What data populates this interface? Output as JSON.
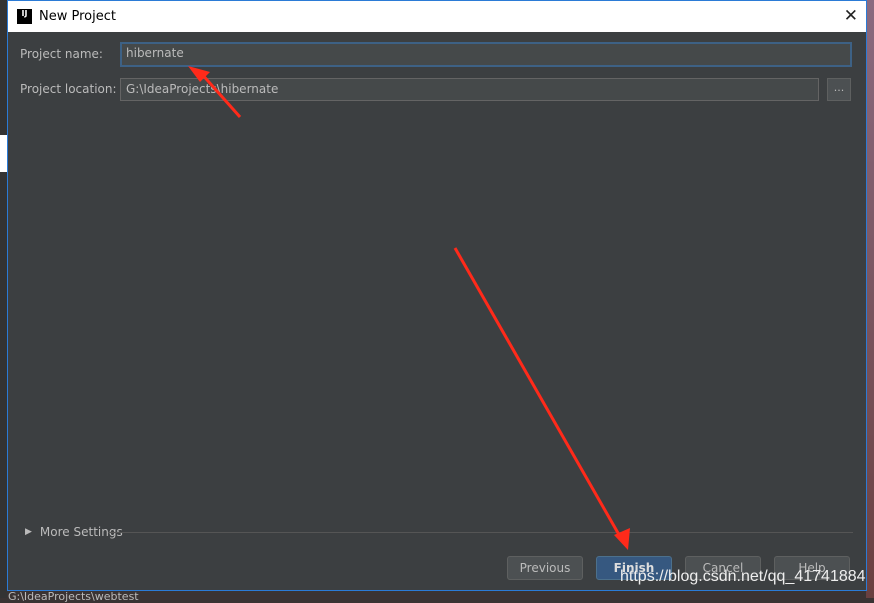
{
  "window": {
    "title": "New Project",
    "logo": "IJ"
  },
  "form": {
    "name_label": "Project name:",
    "name_value": "hibernate",
    "location_label": "Project location:",
    "location_value": "G:\\IdeaProjects\\hibernate",
    "browse_label": "..."
  },
  "more_settings": "More Settings",
  "buttons": {
    "previous": "Previous",
    "finish": "Finish",
    "cancel": "Cancel",
    "help": "Help"
  },
  "watermark": "https://blog.csdn.net/qq_41741884",
  "status": "G:\\IdeaProjects\\webtest",
  "colors": {
    "annotation_arrow": "#ff2a1a",
    "accent": "#365880"
  }
}
